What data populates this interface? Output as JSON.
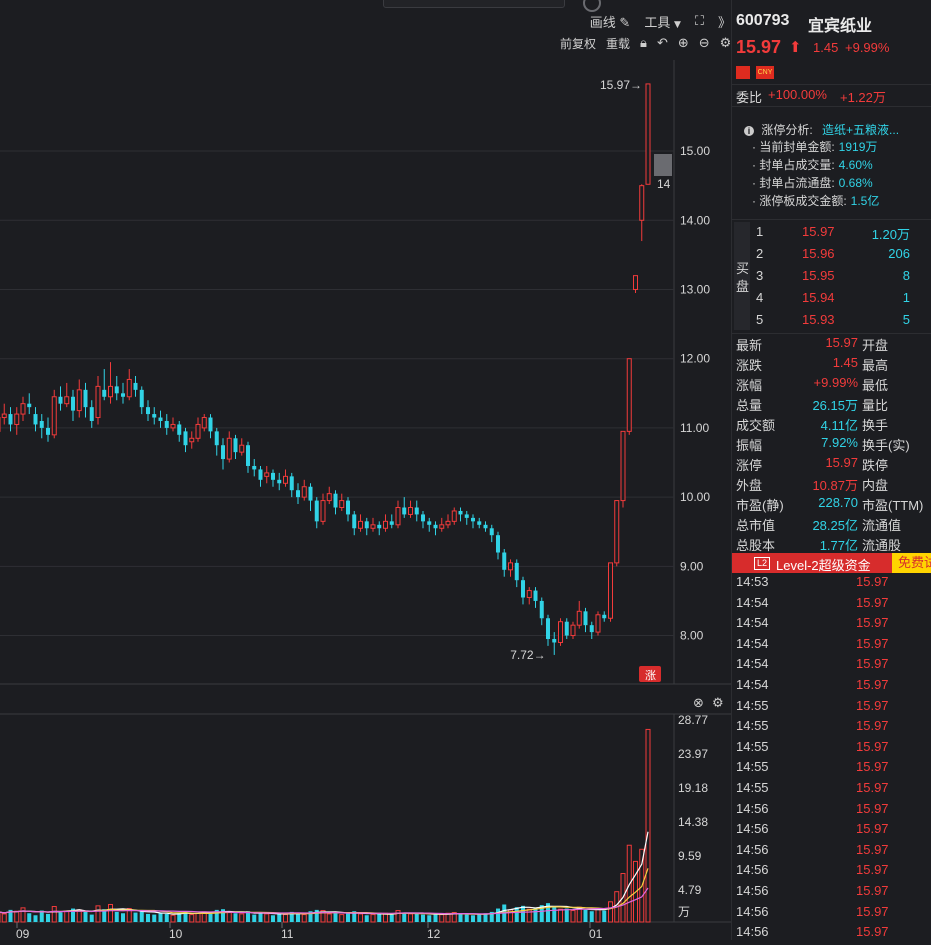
{
  "toolbar": {
    "draw_label": "画线",
    "tools_label": "工具",
    "fq_label": "前复权",
    "reset_label": "重载",
    "expand_label": "》"
  },
  "stock": {
    "code": "600793",
    "name": "宜宾纸业",
    "price": "15.97",
    "change": "1.45",
    "pct": "+9.99%",
    "currency": "CNY"
  },
  "weibi": {
    "label": "委比",
    "pct": "+100.00%",
    "amount": "+1.22万"
  },
  "limit": {
    "title": "涨停分析:",
    "title_val": "造纸+五粮液...",
    "items": [
      {
        "k": "当前封单金额:",
        "v": "1919万"
      },
      {
        "k": "封单占成交量:",
        "v": "4.60%"
      },
      {
        "k": "封单占流通盘:",
        "v": "0.68%"
      },
      {
        "k": "涨停板成交金额:",
        "v": "1.5亿"
      }
    ]
  },
  "orderbook": {
    "side_label_1": "买",
    "side_label_2": "盘",
    "rows": [
      {
        "n": "1",
        "p": "15.97",
        "v": "1.20万"
      },
      {
        "n": "2",
        "p": "15.96",
        "v": "206"
      },
      {
        "n": "3",
        "p": "15.95",
        "v": "8"
      },
      {
        "n": "4",
        "p": "15.94",
        "v": "1"
      },
      {
        "n": "5",
        "p": "15.93",
        "v": "5"
      }
    ]
  },
  "quote": [
    {
      "l": "最新",
      "v": "15.97",
      "c": "red",
      "r": "开盘"
    },
    {
      "l": "涨跌",
      "v": "1.45",
      "c": "red",
      "r": "最高"
    },
    {
      "l": "涨幅",
      "v": "+9.99%",
      "c": "red",
      "r": "最低"
    },
    {
      "l": "总量",
      "v": "26.15万",
      "c": "cyan",
      "r": "量比"
    },
    {
      "l": "成交额",
      "v": "4.11亿",
      "c": "cyan",
      "r": "换手"
    },
    {
      "l": "振幅",
      "v": "7.92%",
      "c": "cyan",
      "r": "换手(实)"
    },
    {
      "l": "涨停",
      "v": "15.97",
      "c": "red",
      "r": "跌停"
    },
    {
      "l": "外盘",
      "v": "10.87万",
      "c": "red",
      "r": "内盘"
    },
    {
      "l": "市盈(静)",
      "v": "228.70",
      "c": "cyan",
      "r": "市盈(TTM)"
    },
    {
      "l": "总市值",
      "v": "28.25亿",
      "c": "cyan",
      "r": "流通值"
    },
    {
      "l": "总股本",
      "v": "1.77亿",
      "c": "cyan",
      "r": "流通股"
    }
  ],
  "level2": {
    "badge": "L2",
    "label": "Level-2超级资金",
    "free": "免费试"
  },
  "ticks": [
    {
      "t": "14:53",
      "p": "15.97"
    },
    {
      "t": "14:54",
      "p": "15.97"
    },
    {
      "t": "14:54",
      "p": "15.97"
    },
    {
      "t": "14:54",
      "p": "15.97"
    },
    {
      "t": "14:54",
      "p": "15.97"
    },
    {
      "t": "14:54",
      "p": "15.97"
    },
    {
      "t": "14:55",
      "p": "15.97"
    },
    {
      "t": "14:55",
      "p": "15.97"
    },
    {
      "t": "14:55",
      "p": "15.97"
    },
    {
      "t": "14:55",
      "p": "15.97"
    },
    {
      "t": "14:55",
      "p": "15.97"
    },
    {
      "t": "14:56",
      "p": "15.97"
    },
    {
      "t": "14:56",
      "p": "15.97"
    },
    {
      "t": "14:56",
      "p": "15.97"
    },
    {
      "t": "14:56",
      "p": "15.97"
    },
    {
      "t": "14:56",
      "p": "15.97"
    },
    {
      "t": "14:56",
      "p": "15.97"
    },
    {
      "t": "14:56",
      "p": "15.97"
    }
  ],
  "colors": {
    "up": "#f23b3b",
    "down": "#31d3e6",
    "bg": "#1c1d21",
    "grid": "#2e2f34"
  },
  "chart_data": {
    "type": "candlestick",
    "price_axis": [
      "15.00",
      "14.00",
      "13.00",
      "12.00",
      "11.00",
      "10.00",
      "9.00",
      "8.00"
    ],
    "ylim": [
      7.3,
      16.2
    ],
    "high_label": "15.97→",
    "low_label": "7.72→",
    "cursor_label": "14",
    "limit_tag": "涨",
    "x_labels": [
      "09",
      "10",
      "11",
      "12",
      "01"
    ],
    "volume_axis": [
      "28.77",
      "23.97",
      "19.18",
      "14.38",
      "9.59",
      "4.79",
      "万"
    ],
    "vol_ylim": [
      0,
      30
    ],
    "candles": [
      [
        10.95,
        11.15,
        11.3,
        10.85
      ],
      [
        11.15,
        11.2,
        11.35,
        11.05
      ],
      [
        11.2,
        11.05,
        11.3,
        10.95
      ],
      [
        11.05,
        11.2,
        11.3,
        10.9
      ],
      [
        11.2,
        11.35,
        11.45,
        11.1
      ],
      [
        11.35,
        11.3,
        11.5,
        11.2
      ],
      [
        11.2,
        11.05,
        11.3,
        10.95
      ],
      [
        11.1,
        11.0,
        11.2,
        10.85
      ],
      [
        11.0,
        10.9,
        11.15,
        10.8
      ],
      [
        10.9,
        11.45,
        11.55,
        10.85
      ],
      [
        11.45,
        11.35,
        11.6,
        11.25
      ],
      [
        11.35,
        11.45,
        11.65,
        11.3
      ],
      [
        11.45,
        11.25,
        11.55,
        11.1
      ],
      [
        11.25,
        11.55,
        11.7,
        11.15
      ],
      [
        11.55,
        11.3,
        11.65,
        11.15
      ],
      [
        11.3,
        11.1,
        11.4,
        11.0
      ],
      [
        11.15,
        11.6,
        11.75,
        11.05
      ],
      [
        11.55,
        11.45,
        11.85,
        11.4
      ],
      [
        11.45,
        11.6,
        11.95,
        11.35
      ],
      [
        11.6,
        11.5,
        11.75,
        11.4
      ],
      [
        11.5,
        11.45,
        11.65,
        11.35
      ],
      [
        11.45,
        11.7,
        11.85,
        11.4
      ],
      [
        11.65,
        11.55,
        11.75,
        11.45
      ],
      [
        11.55,
        11.3,
        11.6,
        11.2
      ],
      [
        11.3,
        11.2,
        11.4,
        11.1
      ],
      [
        11.2,
        11.15,
        11.3,
        11.05
      ],
      [
        11.15,
        11.1,
        11.25,
        11.0
      ],
      [
        11.1,
        11.0,
        11.2,
        10.9
      ],
      [
        11.0,
        11.05,
        11.15,
        10.95
      ],
      [
        11.05,
        10.9,
        11.1,
        10.8
      ],
      [
        10.95,
        10.75,
        11.0,
        10.65
      ],
      [
        10.8,
        10.85,
        10.95,
        10.7
      ],
      [
        10.85,
        11.05,
        11.15,
        10.8
      ],
      [
        11.0,
        11.15,
        11.2,
        10.95
      ],
      [
        11.15,
        10.95,
        11.2,
        10.85
      ],
      [
        10.95,
        10.75,
        11.0,
        10.6
      ],
      [
        10.75,
        10.55,
        10.85,
        10.4
      ],
      [
        10.55,
        10.85,
        10.95,
        10.5
      ],
      [
        10.85,
        10.65,
        10.9,
        10.55
      ],
      [
        10.65,
        10.75,
        10.85,
        10.6
      ],
      [
        10.75,
        10.45,
        10.8,
        10.35
      ],
      [
        10.45,
        10.4,
        10.55,
        10.3
      ],
      [
        10.4,
        10.25,
        10.45,
        10.15
      ],
      [
        10.3,
        10.35,
        10.45,
        10.2
      ],
      [
        10.35,
        10.25,
        10.4,
        10.15
      ],
      [
        10.25,
        10.2,
        10.35,
        10.1
      ],
      [
        10.2,
        10.3,
        10.4,
        10.15
      ],
      [
        10.3,
        10.1,
        10.35,
        10.0
      ],
      [
        10.1,
        10.0,
        10.2,
        9.9
      ],
      [
        10.0,
        10.15,
        10.25,
        9.95
      ],
      [
        10.15,
        9.95,
        10.2,
        9.8
      ],
      [
        9.95,
        9.65,
        10.0,
        9.55
      ],
      [
        9.65,
        9.95,
        10.05,
        9.6
      ],
      [
        9.95,
        10.05,
        10.15,
        9.9
      ],
      [
        10.05,
        9.85,
        10.1,
        9.75
      ],
      [
        9.85,
        9.95,
        10.05,
        9.8
      ],
      [
        9.95,
        9.75,
        10.0,
        9.65
      ],
      [
        9.75,
        9.55,
        9.8,
        9.45
      ],
      [
        9.55,
        9.65,
        9.75,
        9.5
      ],
      [
        9.65,
        9.55,
        9.7,
        9.45
      ],
      [
        9.55,
        9.6,
        9.7,
        9.5
      ],
      [
        9.6,
        9.55,
        9.65,
        9.45
      ],
      [
        9.55,
        9.65,
        9.75,
        9.5
      ],
      [
        9.65,
        9.6,
        9.75,
        9.55
      ],
      [
        9.6,
        9.85,
        9.95,
        9.55
      ],
      [
        9.85,
        9.75,
        10.0,
        9.7
      ],
      [
        9.75,
        9.85,
        9.95,
        9.7
      ],
      [
        9.85,
        9.75,
        9.95,
        9.65
      ],
      [
        9.75,
        9.65,
        9.8,
        9.55
      ],
      [
        9.65,
        9.6,
        9.7,
        9.5
      ],
      [
        9.6,
        9.55,
        9.65,
        9.45
      ],
      [
        9.55,
        9.6,
        9.7,
        9.5
      ],
      [
        9.6,
        9.65,
        9.75,
        9.55
      ],
      [
        9.65,
        9.8,
        9.85,
        9.6
      ],
      [
        9.8,
        9.75,
        9.85,
        9.65
      ],
      [
        9.75,
        9.7,
        9.8,
        9.6
      ],
      [
        9.7,
        9.65,
        9.75,
        9.55
      ],
      [
        9.65,
        9.6,
        9.7,
        9.55
      ],
      [
        9.6,
        9.55,
        9.65,
        9.5
      ],
      [
        9.55,
        9.45,
        9.6,
        9.35
      ],
      [
        9.45,
        9.2,
        9.5,
        9.1
      ],
      [
        9.2,
        8.95,
        9.25,
        8.85
      ],
      [
        8.95,
        9.05,
        9.1,
        8.85
      ],
      [
        9.05,
        8.8,
        9.1,
        8.7
      ],
      [
        8.8,
        8.55,
        8.85,
        8.45
      ],
      [
        8.55,
        8.65,
        8.7,
        8.45
      ],
      [
        8.65,
        8.5,
        8.7,
        8.4
      ],
      [
        8.5,
        8.25,
        8.55,
        8.15
      ],
      [
        8.25,
        7.95,
        8.3,
        7.85
      ],
      [
        7.95,
        7.9,
        8.05,
        7.72
      ],
      [
        7.9,
        8.2,
        8.25,
        7.85
      ],
      [
        8.2,
        8.0,
        8.25,
        7.95
      ],
      [
        8.0,
        8.15,
        8.2,
        7.95
      ],
      [
        8.15,
        8.35,
        8.5,
        8.1
      ],
      [
        8.35,
        8.15,
        8.4,
        8.05
      ],
      [
        8.15,
        8.05,
        8.2,
        7.95
      ],
      [
        8.05,
        8.3,
        8.35,
        8.0
      ],
      [
        8.3,
        8.25,
        8.35,
        8.2
      ],
      [
        8.25,
        9.05,
        9.05,
        8.2
      ],
      [
        9.05,
        9.95,
        9.95,
        9.0
      ],
      [
        9.95,
        10.95,
        10.95,
        9.85
      ],
      [
        10.95,
        12.0,
        12.0,
        10.9
      ],
      [
        13.0,
        13.2,
        13.2,
        12.95
      ],
      [
        14.0,
        14.5,
        14.52,
        13.7
      ],
      [
        14.52,
        15.97,
        15.97,
        14.52
      ]
    ],
    "volumes": [
      1.5,
      1.2,
      1.8,
      1.6,
      2.1,
      1.3,
      1.0,
      1.7,
      1.2,
      2.3,
      1.4,
      1.6,
      2.0,
      1.8,
      1.5,
      1.1,
      2.4,
      1.9,
      2.6,
      1.5,
      1.3,
      2.0,
      1.4,
      1.7,
      1.2,
      1.1,
      1.3,
      1.2,
      1.0,
      1.4,
      1.6,
      1.1,
      1.3,
      1.5,
      1.2,
      1.8,
      1.9,
      1.4,
      1.3,
      1.2,
      1.6,
      1.1,
      1.4,
      1.2,
      1.0,
      1.3,
      1.1,
      1.5,
      1.2,
      1.1,
      1.6,
      1.8,
      1.7,
      1.2,
      1.3,
      1.1,
      1.4,
      1.6,
      1.2,
      1.0,
      1.1,
      1.2,
      1.3,
      1.1,
      1.7,
      1.4,
      1.2,
      1.3,
      1.1,
      1.0,
      1.2,
      1.1,
      1.3,
      1.4,
      1.2,
      1.1,
      1.0,
      1.2,
      1.3,
      1.5,
      2.0,
      2.6,
      1.8,
      2.2,
      2.4,
      1.9,
      2.1,
      2.5,
      2.8,
      2.3,
      1.9,
      2.0,
      1.7,
      2.2,
      1.8,
      1.6,
      1.9,
      1.7,
      3.0,
      4.5,
      7.2,
      11.4,
      9.0,
      10.8,
      28.6
    ],
    "ma_lines": [
      {
        "color": "#ffffff",
        "values_from": 83
      },
      {
        "color": "#f5d142",
        "values_from": 83
      },
      {
        "color": "#e066e0",
        "values_from": 83
      }
    ]
  }
}
